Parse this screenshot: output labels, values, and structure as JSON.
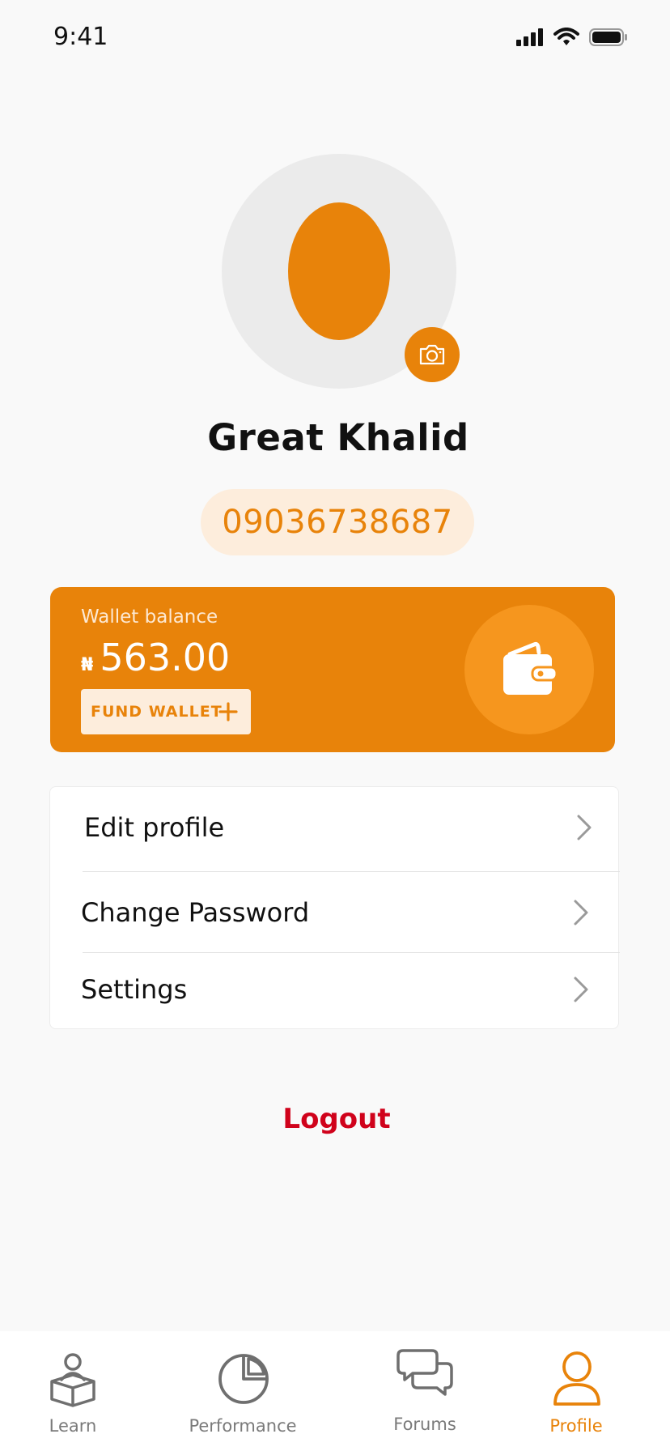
{
  "status_bar": {
    "time": "9:41"
  },
  "profile": {
    "name": "Great Khalid",
    "phone": "09036738687"
  },
  "wallet": {
    "label": "Wallet balance",
    "currency_symbol": "₦",
    "balance": "563.00",
    "fund_button_label": "FUND WALLET"
  },
  "menu": {
    "items": [
      {
        "label": "Edit profile"
      },
      {
        "label": "Change Password"
      },
      {
        "label": "Settings"
      }
    ]
  },
  "logout_label": "Logout",
  "tabbar": {
    "active": "Profile",
    "tabs": [
      {
        "label": "Learn",
        "icon": "learn-icon"
      },
      {
        "label": "Performance",
        "icon": "pie-chart-icon"
      },
      {
        "label": "Forums",
        "icon": "chat-bubbles-icon"
      },
      {
        "label": "Profile",
        "icon": "user-icon"
      }
    ]
  },
  "colors": {
    "accent": "#e8830a",
    "accent_light": "#fdeddc",
    "logout": "#d0021b",
    "background": "#f9f9f9"
  }
}
